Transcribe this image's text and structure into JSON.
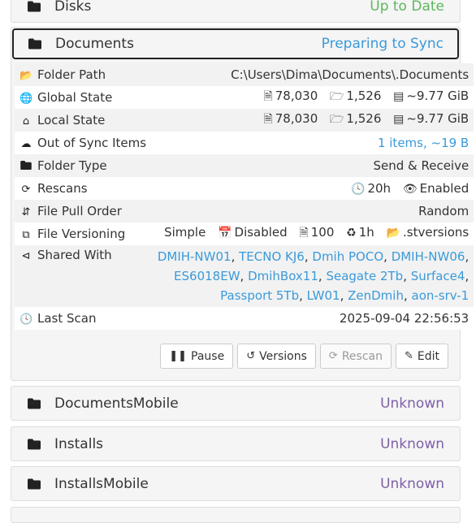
{
  "folders": {
    "disks": {
      "name": "Disks",
      "status": "Up to Date"
    },
    "documents": {
      "name": "Documents",
      "status": "Preparing to Sync"
    },
    "documents_mobile": {
      "name": "DocumentsMobile",
      "status": "Unknown"
    },
    "installs": {
      "name": "Installs",
      "status": "Unknown"
    },
    "installs_mobile": {
      "name": "InstallsMobile",
      "status": "Unknown"
    }
  },
  "details": {
    "folder_path": {
      "label": "Folder Path",
      "value": "C:\\Users\\Dima\\Documents\\.Documents"
    },
    "global_state": {
      "label": "Global State",
      "files": "78,030",
      "dirs": "1,526",
      "size": "~9.77 GiB"
    },
    "local_state": {
      "label": "Local State",
      "files": "78,030",
      "dirs": "1,526",
      "size": "~9.77 GiB"
    },
    "out_of_sync": {
      "label": "Out of Sync Items",
      "value": "1 items, ~19 B"
    },
    "folder_type": {
      "label": "Folder Type",
      "value": "Send & Receive"
    },
    "rescans": {
      "label": "Rescans",
      "interval": "20h",
      "watcher": "Enabled"
    },
    "pull_order": {
      "label": "File Pull Order",
      "value": "Random"
    },
    "versioning": {
      "label": "File Versioning",
      "type": "Simple",
      "cleanup": "Disabled",
      "keep": "100",
      "interval": "1h",
      "path": ".stversions"
    },
    "shared_with": {
      "label": "Shared With",
      "devices": [
        "DMIH-NW01",
        "TECNO KJ6",
        "Dmih POCO",
        "DMIH-NW06",
        "ES6018EW",
        "DmihBox11",
        "Seagate 2Tb",
        "Surface4",
        "Passport 5Tb",
        "LW01",
        "ZenDmih",
        "aon-srv-1"
      ]
    },
    "last_scan": {
      "label": "Last Scan",
      "value": "2025-09-04 22:56:53"
    }
  },
  "buttons": {
    "pause": "Pause",
    "versions": "Versions",
    "rescan": "Rescan",
    "edit": "Edit"
  },
  "colors": {
    "up_to_date": "#5cb85c",
    "syncing": "#3a9ad9",
    "unknown": "#7f5fa8",
    "link": "#3a9ad9"
  }
}
